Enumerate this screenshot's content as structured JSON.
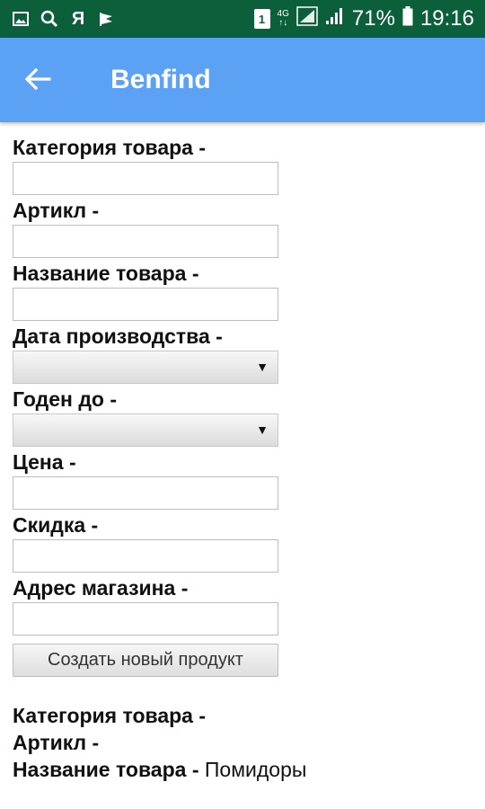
{
  "status_bar": {
    "icons_left": [
      "image-icon",
      "search-icon",
      "yandex-icon",
      "flag-icon"
    ],
    "yandex_glyph": "Я",
    "sim_label": "1",
    "network_top": "4G",
    "network_bottom": "↑↓",
    "battery": "71%",
    "time": "19:16"
  },
  "app_bar": {
    "title": "Benfind",
    "color": "#5ba2f4"
  },
  "form": {
    "category_label": "Категория товара -",
    "article_label": "Артикл -",
    "name_label": "Название товара -",
    "production_date_label": "Дата производства -",
    "production_date_value": "",
    "expires_label": "Годен до -",
    "expires_value": "",
    "price_label": "Цена -",
    "discount_label": "Скидка -",
    "address_label": "Адрес магазина -",
    "submit_label": "Создать новый продукт"
  },
  "result": {
    "category_label": "Категория товара -",
    "category_value": "",
    "article_label": "Артикл -",
    "article_value": "",
    "name_label": "Название товара -",
    "name_value": " Помидоры"
  }
}
